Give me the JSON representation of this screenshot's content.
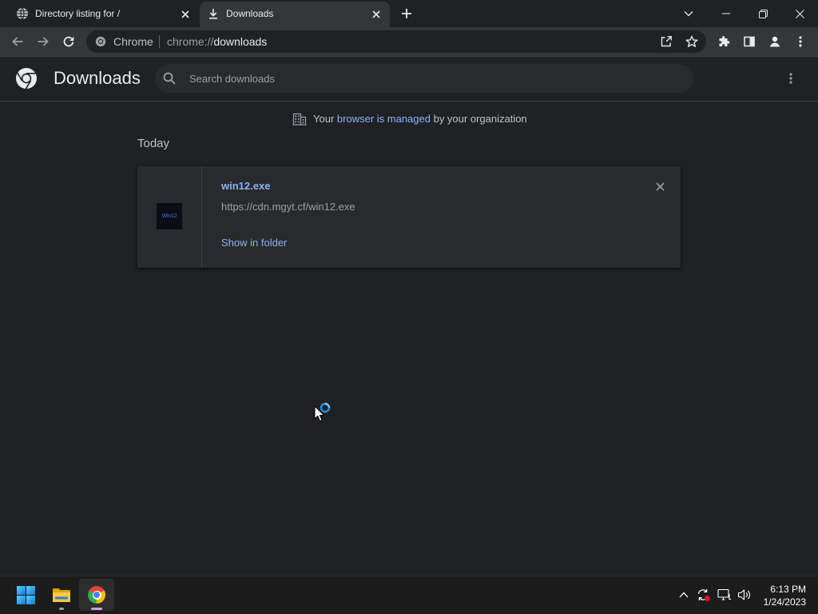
{
  "browser": {
    "tabs": [
      {
        "title": "Directory listing for /",
        "icon": "globe-icon",
        "active": false
      },
      {
        "title": "Downloads",
        "icon": "download-icon",
        "active": true
      }
    ],
    "window_controls": [
      "tab-search-chevron-icon",
      "minimize-icon",
      "restore-icon",
      "close-icon"
    ],
    "toolbar": {
      "nav_icons": [
        "back-arrow-icon",
        "forward-arrow-icon",
        "reload-icon"
      ],
      "omnibox": {
        "chip_label": "Chrome",
        "url_scheme": "chrome://",
        "url_path": "downloads",
        "icons": [
          "share-icon",
          "star-icon"
        ]
      },
      "right_icons": [
        "extensions-puzzle-icon",
        "side-panel-icon",
        "profile-icon",
        "kebab-menu-icon"
      ]
    }
  },
  "page": {
    "title": "Downloads",
    "logo_icon": "chrome-logo-icon",
    "search": {
      "placeholder": "Search downloads",
      "icon": "search-icon"
    },
    "menu_icon": "kebab-menu-icon",
    "managed_notice": {
      "icon": "building-icon",
      "prefix": "Your",
      "link": "browser is managed",
      "suffix": "by your organization"
    },
    "sections": [
      {
        "label": "Today",
        "items": [
          {
            "file_name": "win12.exe",
            "url": "https://cdn.mgyt.cf/win12.exe",
            "action": "Show in folder",
            "thumbnail_text": "Win12",
            "remove_icon": "close-icon"
          }
        ]
      }
    ]
  },
  "taskbar": {
    "pinned_icons": [
      "windows-start-icon",
      "file-explorer-icon",
      "chrome-icon"
    ],
    "tray_icons": [
      "chevron-up-icon",
      "sync-icon",
      "network-icon",
      "volume-icon"
    ],
    "time": "6:13 PM",
    "date": "1/24/2023"
  },
  "colors": {
    "page_bg": "#202124",
    "toolbar_bg": "#35363a",
    "card_bg": "#292a2d",
    "link": "#8ab4f8",
    "secondary_text": "#9aa0a6",
    "tray_alert": "#e81123",
    "chrome_indicator": "#c9a0dc"
  }
}
